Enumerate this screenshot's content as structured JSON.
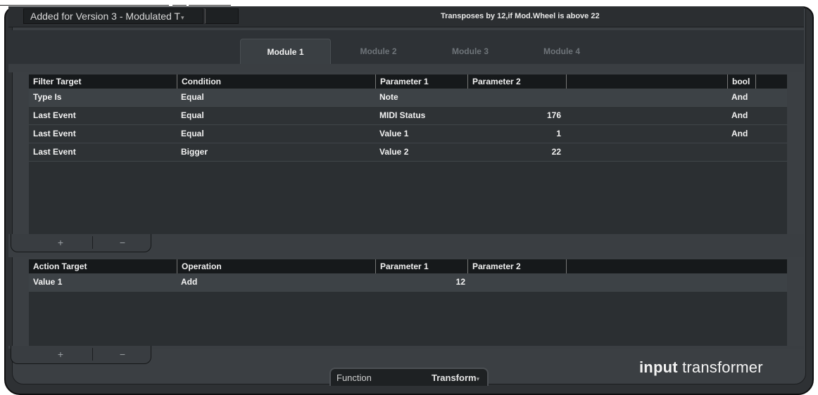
{
  "header": {
    "preset_name": "Added for Version 3 - Modulated T",
    "preset_arrow": "▾",
    "description": "Transposes by 12,if Mod.Wheel is above 22"
  },
  "tabs": [
    {
      "label": "Module 1",
      "active": true
    },
    {
      "label": "Module 2",
      "active": false
    },
    {
      "label": "Module 3",
      "active": false
    },
    {
      "label": "Module 4",
      "active": false
    }
  ],
  "filter_table": {
    "columns": [
      "Filter Target",
      "Condition",
      "Parameter 1",
      "Parameter 2",
      "bool"
    ],
    "rows": [
      {
        "target": "Type Is",
        "condition": "Equal",
        "param1": "Note",
        "param2": "",
        "bool": "And"
      },
      {
        "target": "Last Event",
        "condition": "Equal",
        "param1": "MIDI Status",
        "param2": "176",
        "bool": "And"
      },
      {
        "target": "Last Event",
        "condition": "Equal",
        "param1": "Value 1",
        "param2": "1",
        "bool": "And"
      },
      {
        "target": "Last Event",
        "condition": "Bigger",
        "param1": "Value 2",
        "param2": "22",
        "bool": ""
      }
    ],
    "add_label": "+",
    "remove_label": "−"
  },
  "action_table": {
    "columns": [
      "Action Target",
      "Operation",
      "Parameter 1",
      "Parameter 2"
    ],
    "rows": [
      {
        "target": "Value 1",
        "operation": "Add",
        "param1": "12",
        "param2": ""
      }
    ],
    "add_label": "+",
    "remove_label": "−"
  },
  "function": {
    "label": "Function",
    "value": "Transform",
    "arrow": "▾"
  },
  "brand": {
    "bold": "input",
    "light": " transformer"
  }
}
